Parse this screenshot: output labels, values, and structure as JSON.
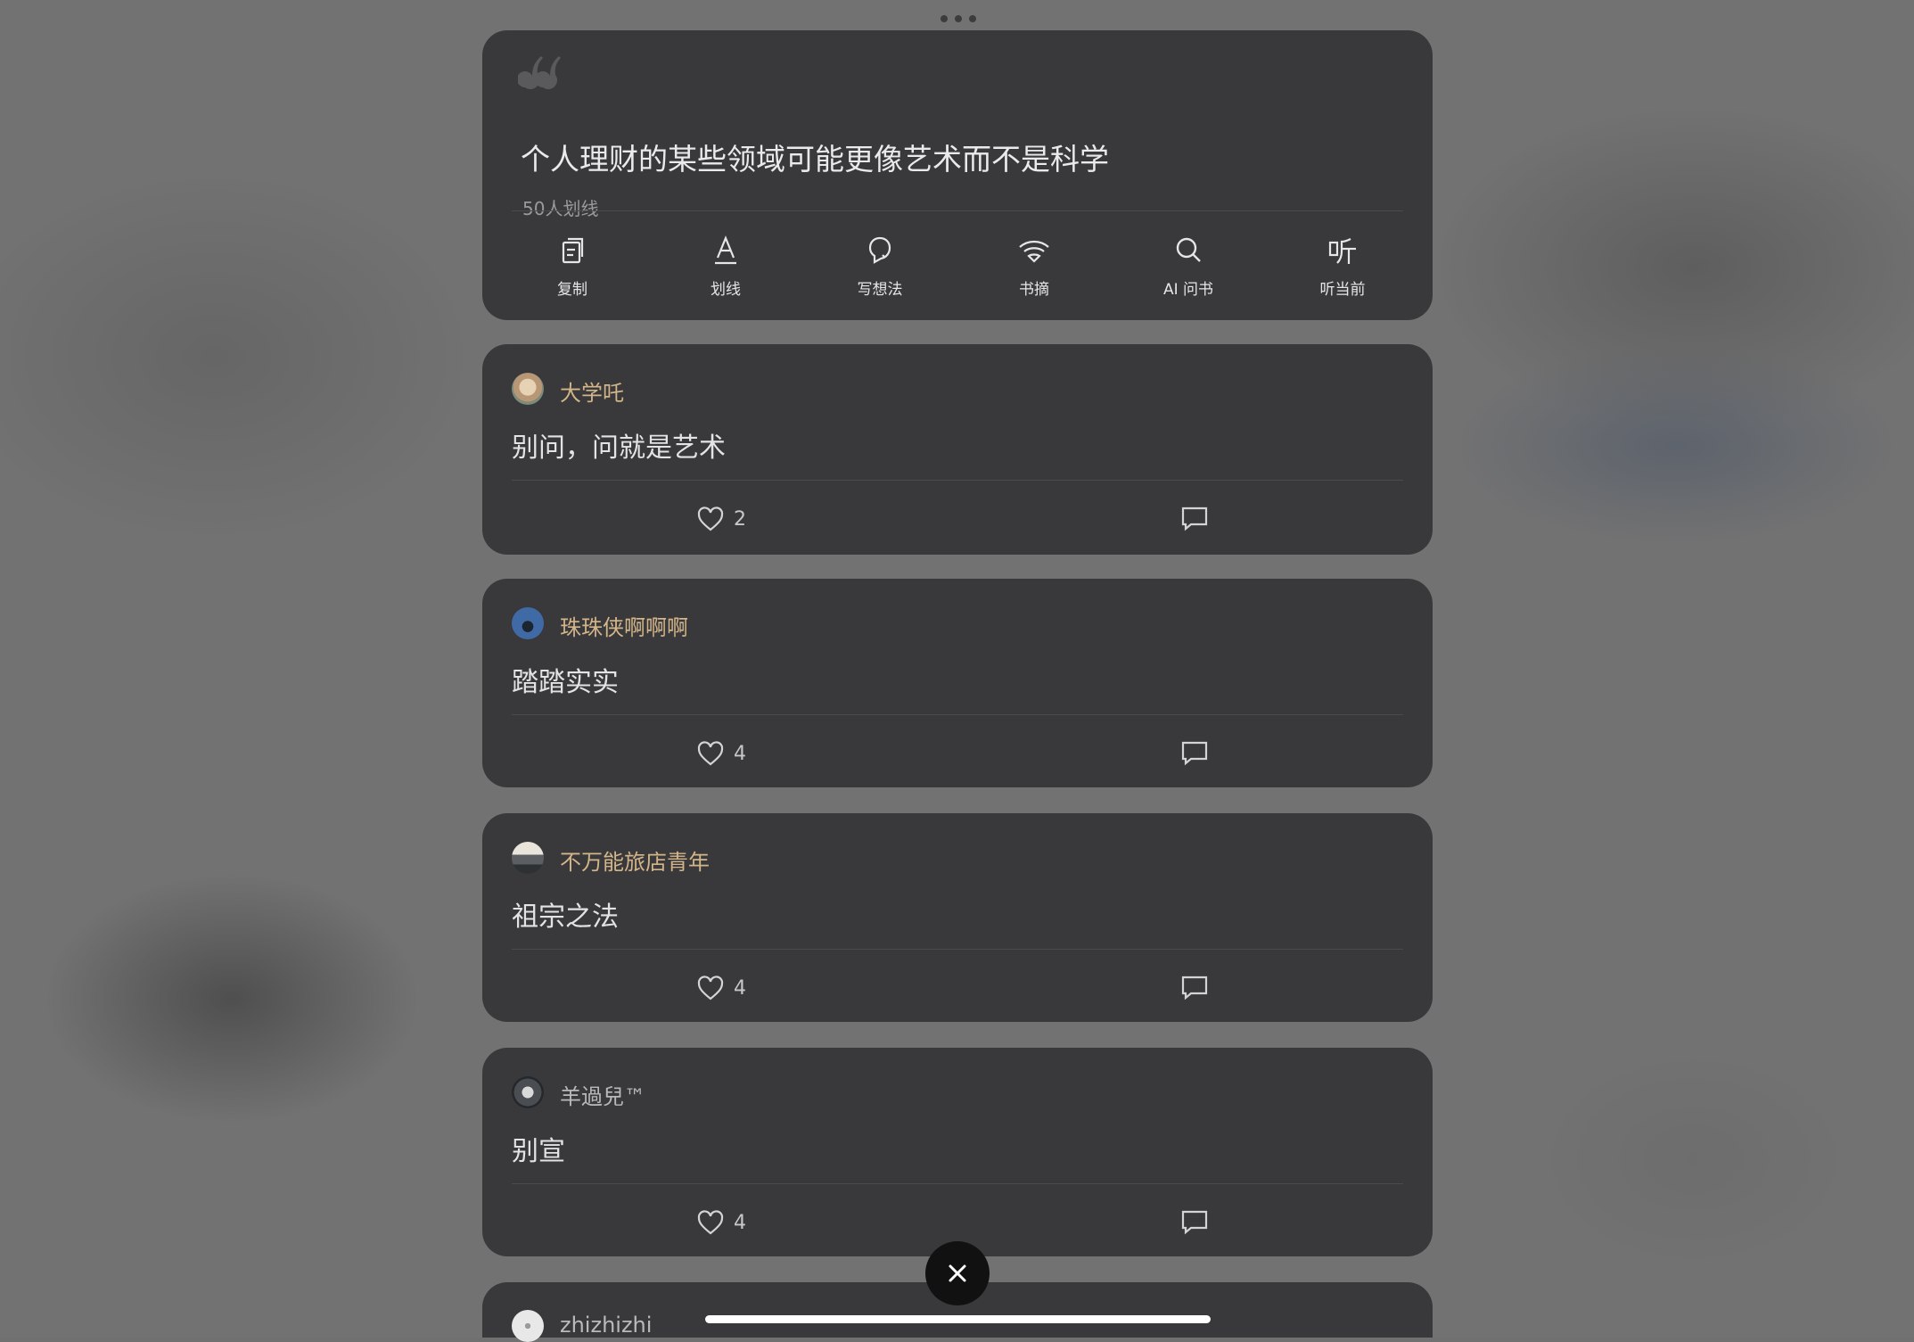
{
  "quote": {
    "text": "个人理财的某些领域可能更像艺术而不是科学",
    "highlight_count": "50人划线"
  },
  "toolbar": [
    {
      "label": "复制",
      "icon": "copy-icon"
    },
    {
      "label": "划线",
      "icon": "underline-icon"
    },
    {
      "label": "写想法",
      "icon": "thought-icon"
    },
    {
      "label": "书摘",
      "icon": "excerpt-icon"
    },
    {
      "label": "AI 问书",
      "icon": "search-icon"
    },
    {
      "label": "听当前",
      "icon": "listen-icon"
    }
  ],
  "comments": [
    {
      "user": "大学吒",
      "text": "别问，问就是艺术",
      "likes": "2",
      "name_color": "#d3b58a"
    },
    {
      "user": "珠珠侠啊啊啊",
      "text": "踏踏实实",
      "likes": "4",
      "name_color": "#d3b58a"
    },
    {
      "user": "不万能旅店青年",
      "text": "祖宗之法",
      "likes": "4",
      "name_color": "#d3b58a"
    },
    {
      "user": "羊過兒™",
      "text": "别宣",
      "likes": "4",
      "name_color": "#b9b9b9"
    },
    {
      "user": "zhizhizhi",
      "text": "",
      "likes": "",
      "name_color": "#b9b9b9"
    }
  ],
  "colors": {
    "background": "#727272",
    "card": "#39393b",
    "accent_name": "#d3b58a"
  }
}
